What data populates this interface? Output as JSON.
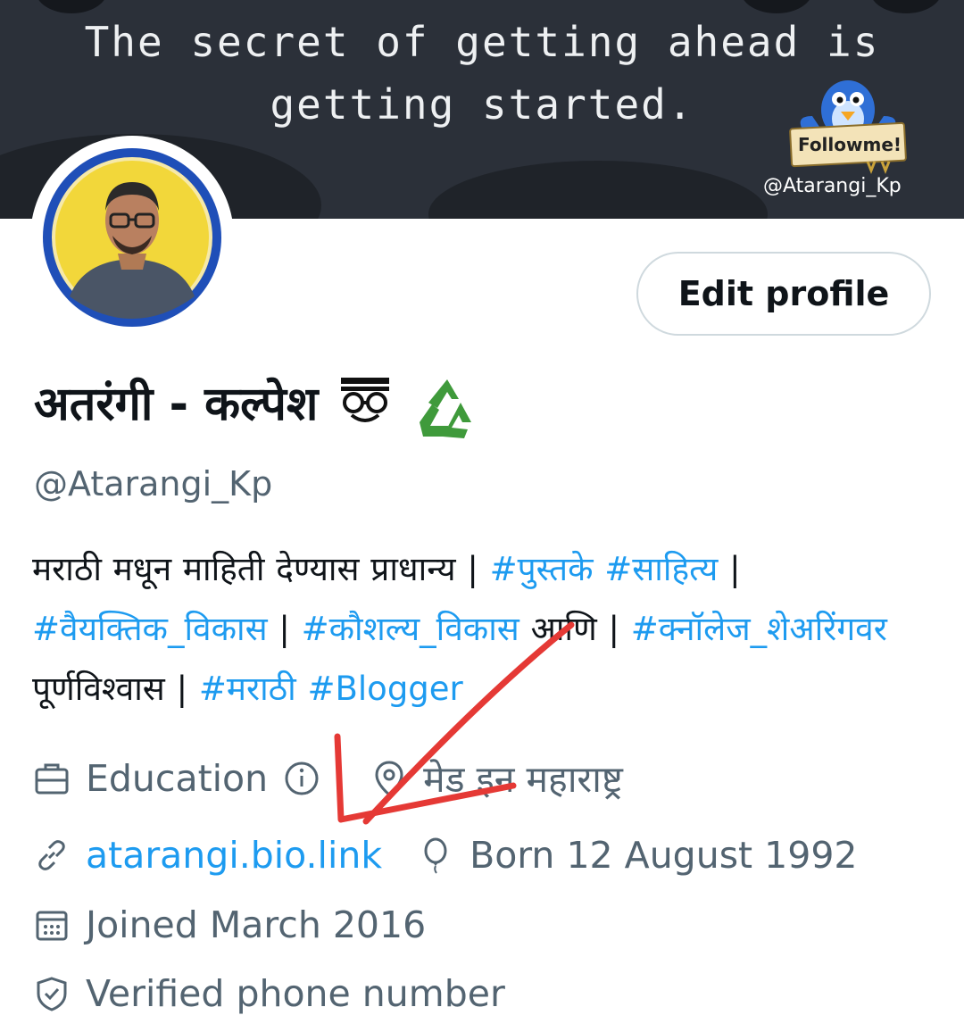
{
  "banner": {
    "quote": "The secret of getting ahead is\ngetting started.",
    "sticker_text": "Followme!",
    "sticker_handle": "@Atarangi_Kp",
    "background_color": "#2b3039"
  },
  "profile": {
    "avatar_icon": "profile-photo",
    "display_name": "अतरंगी - कल्पेश",
    "name_emojis": [
      "nerd-face-emoji",
      "recycling-symbol-emoji"
    ],
    "handle": "@Atarangi_Kp",
    "edit_button_label": "Edit profile",
    "bio": [
      {
        "text": "मराठी मधून माहिती देण्यास प्राधान्य  | ",
        "hashtag": false
      },
      {
        "text": "#पुस्तके",
        "hashtag": true
      },
      {
        "text": " ",
        "hashtag": false
      },
      {
        "text": "#साहित्य",
        "hashtag": true
      },
      {
        "text": " | ",
        "hashtag": false
      },
      {
        "text": "#वैयक्तिक_विकास",
        "hashtag": true
      },
      {
        "text": " | ",
        "hashtag": false
      },
      {
        "text": "#कौशल्य_विकास",
        "hashtag": true
      },
      {
        "text": " आणि | ",
        "hashtag": false
      },
      {
        "text": "#क्नॉलेज_शेअरिंगवर",
        "hashtag": true
      },
      {
        "text": " पूर्णविश्वास | ",
        "hashtag": false
      },
      {
        "text": "#मराठी",
        "hashtag": true
      },
      {
        "text": " ",
        "hashtag": false
      },
      {
        "text": "#Blogger",
        "hashtag": true
      }
    ],
    "meta": {
      "category": "Education",
      "location": "मेड इन महाराष्ट्र",
      "website": "atarangi.bio.link",
      "birthday": "Born 12 August 1992",
      "joined": "Joined March 2016",
      "verified": "Verified phone number"
    }
  },
  "colors": {
    "link": "#1d9bf0",
    "secondary_text": "#536471",
    "primary_text": "#0f1419",
    "annotation_arrow": "#e53935"
  }
}
